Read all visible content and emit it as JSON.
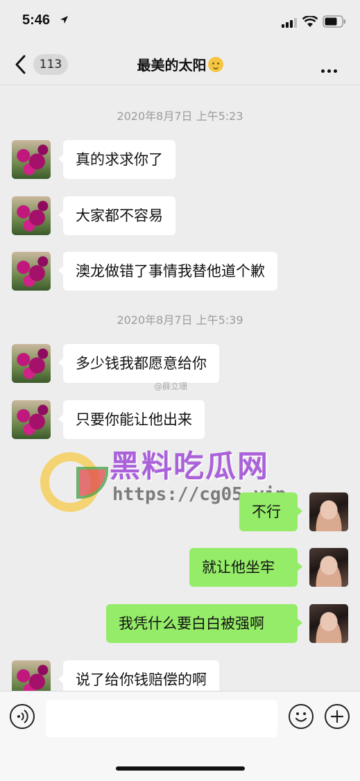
{
  "status_bar": {
    "time": "5:46"
  },
  "nav": {
    "back_count": "113",
    "title": "最美的太阳"
  },
  "timestamps": [
    "2020年8月7日 上午5:23",
    "2020年8月7日 上午5:39"
  ],
  "messages": [
    {
      "side": "in",
      "text": "真的求求你了"
    },
    {
      "side": "in",
      "text": "大家都不容易"
    },
    {
      "side": "in",
      "text": "澳龙做错了事情我替他道个歉"
    },
    {
      "side": "in",
      "text": "多少钱我都愿意给你"
    },
    {
      "side": "in",
      "text": "只要你能让他出来"
    },
    {
      "side": "out",
      "text": "不行"
    },
    {
      "side": "out",
      "text": "就让他坐牢"
    },
    {
      "side": "out",
      "text": "我凭什么要白白被强啊"
    },
    {
      "side": "in",
      "text": "说了给你钱赔偿的啊"
    }
  ],
  "watermark": {
    "weibo": "@薛立珊",
    "title": "黑料吃瓜网",
    "url": "https://cg05.vip"
  },
  "icons": {
    "voice": "voice-icon",
    "emoji": "emoji-icon",
    "plus": "plus-icon"
  },
  "colors": {
    "outgoing_bubble": "#95ec69",
    "incoming_bubble": "#ffffff",
    "background": "#ededed"
  }
}
